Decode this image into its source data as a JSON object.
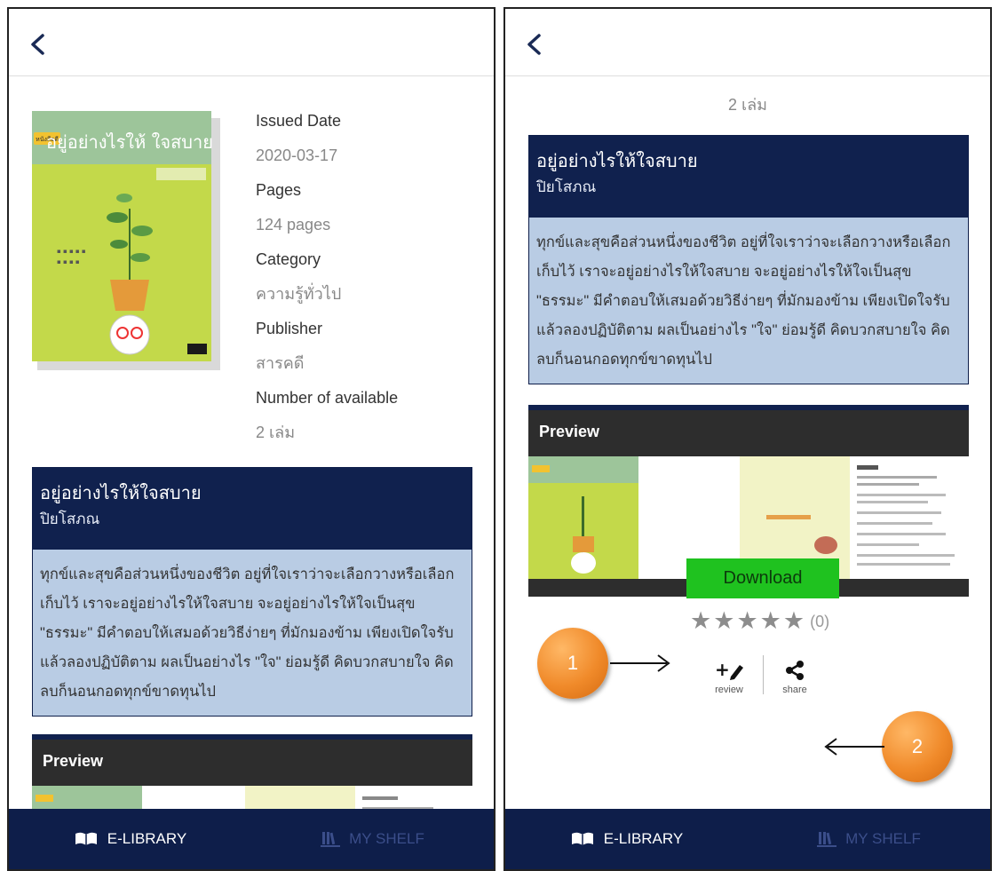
{
  "book": {
    "title": "อยู่อย่างไรให้ใจสบาย",
    "author": "ปิยโสภณ",
    "description": "ทุกข์และสุขคือส่วนหนึ่งของชีวิต อยู่ที่ใจเราว่าจะเลือกวางหรือเลือกเก็บไว้ เราจะอยู่อย่างไรให้ใจสบาย จะอยู่อย่างไรให้ใจเป็นสุข \"ธรรมะ\" มีคำตอบให้เสมอด้วยวิธีง่ายๆ ที่มักมองข้าม เพียงเปิดใจรับ แล้วลองปฏิบัติตาม ผลเป็นอย่างไร \"ใจ\" ย่อมรู้ดี คิดบวกสบายใจ คิดลบก็นอนกอดทุกข์ขาดทุนไป",
    "cover_title": "อยู่อย่างไรให้ ใจสบาย",
    "cover_badge": "หนังสือดี"
  },
  "meta": [
    {
      "label": "Issued Date",
      "value": "2020-03-17"
    },
    {
      "label": "Pages",
      "value": "124 pages"
    },
    {
      "label": "Category",
      "value": "ความรู้ทั่วไป"
    },
    {
      "label": "Publisher",
      "value": "สารคดี"
    },
    {
      "label": "Number of available",
      "value": "2 เล่ม"
    }
  ],
  "preview": {
    "title": "Preview"
  },
  "actions": {
    "download_label": "Download",
    "rating_count": "(0)",
    "stars": 5,
    "review_label": "review",
    "share_label": "share"
  },
  "nav": {
    "library_label": "E-LIBRARY",
    "shelf_label": "MY SHELF"
  },
  "callouts": [
    "1",
    "2"
  ],
  "colors": {
    "navy": "#10214e",
    "card_body": "#b9cce4",
    "download_green": "#1fc21f",
    "callout_orange": "#f08a2a",
    "nav_inactive": "#3b4e8a"
  }
}
